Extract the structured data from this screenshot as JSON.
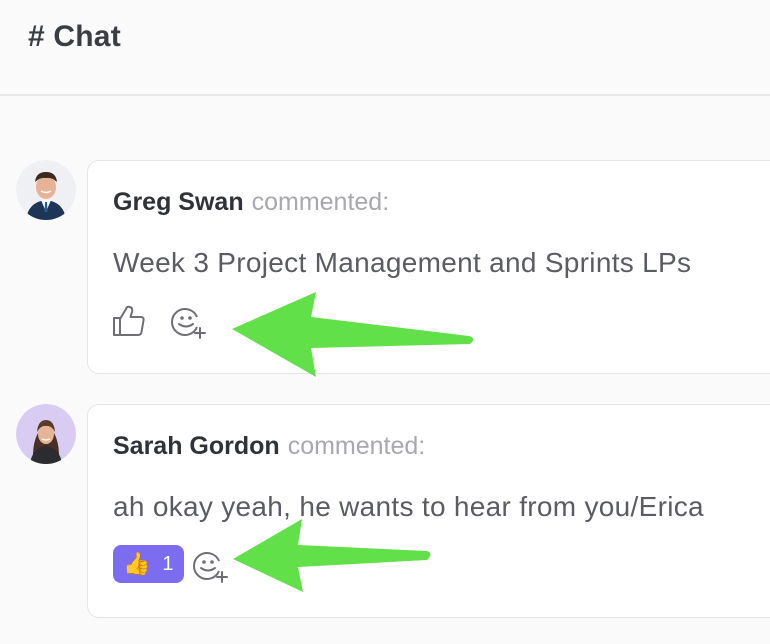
{
  "header": {
    "title": "# Chat"
  },
  "comments": [
    {
      "author": "Greg Swan",
      "verb": "commented:",
      "text": "Week 3 Project Management and Sprints LPs",
      "avatar_icon": "avatar-photo-man"
    },
    {
      "author": "Sarah Gordon",
      "verb": "commented:",
      "text": "ah okay yeah, he wants to hear from you/Erica",
      "avatar_icon": "avatar-photo-woman",
      "reaction": {
        "emoji": "👍",
        "count": "1",
        "color": "#7b6cf0"
      }
    }
  ],
  "colors": {
    "arrow": "#62e04a",
    "reaction_pill": "#7b6cf0",
    "muted_text": "#a8a8ad"
  },
  "icons": [
    "thumbs-up-icon",
    "add-emoji-icon",
    "arrow-annotation"
  ]
}
